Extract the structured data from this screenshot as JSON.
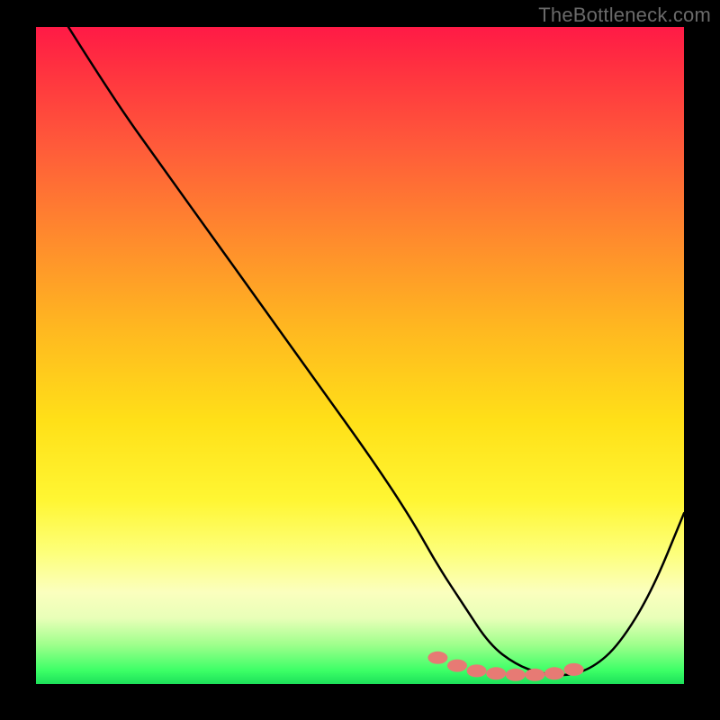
{
  "watermark": "TheBottleneck.com",
  "chart_data": {
    "type": "line",
    "title": "",
    "xlabel": "",
    "ylabel": "",
    "xlim": [
      0,
      100
    ],
    "ylim": [
      0,
      100
    ],
    "grid": false,
    "legend": false,
    "series": [
      {
        "name": "curve",
        "x": [
          5,
          12,
          20,
          28,
          36,
          44,
          52,
          58,
          62,
          66,
          70,
          74,
          78,
          82,
          86,
          90,
          95,
          100
        ],
        "values": [
          100,
          89,
          78,
          67,
          56,
          45,
          34,
          25,
          18,
          12,
          6,
          3,
          1.5,
          1.2,
          2.5,
          6,
          14,
          26
        ]
      }
    ],
    "markers": {
      "name": "highlight-dots",
      "x": [
        62,
        65,
        68,
        71,
        74,
        77,
        80,
        83
      ],
      "values": [
        4.0,
        2.8,
        2.0,
        1.6,
        1.4,
        1.4,
        1.6,
        2.2
      ]
    },
    "gradient_stops": [
      {
        "pos": 0,
        "color": "#ff1a46"
      },
      {
        "pos": 18,
        "color": "#ff5a3a"
      },
      {
        "pos": 46,
        "color": "#ffb820"
      },
      {
        "pos": 72,
        "color": "#fff633"
      },
      {
        "pos": 90,
        "color": "#e8ffb8"
      },
      {
        "pos": 100,
        "color": "#1de05a"
      }
    ]
  }
}
